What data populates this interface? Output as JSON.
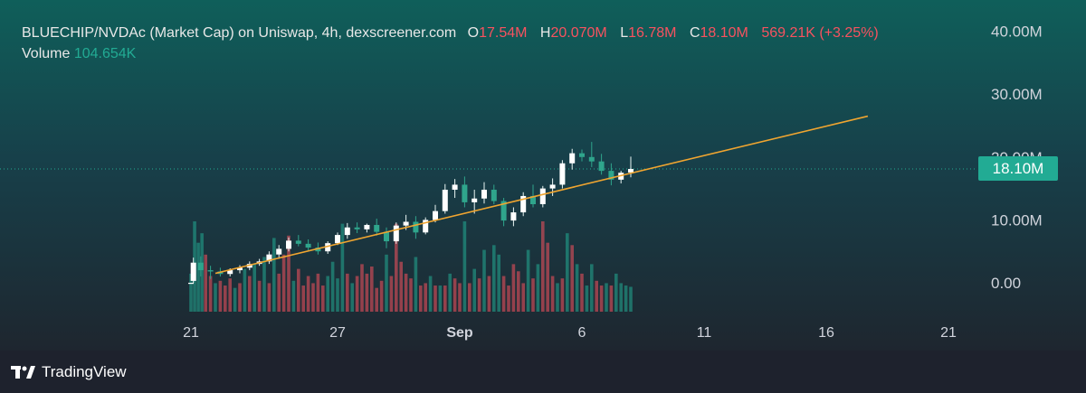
{
  "legend": {
    "title": "BLUECHIP/NVDAc (Market Cap) on Uniswap, 4h, dexscreener.com",
    "o_key": "O",
    "o_val": "17.54M",
    "h_key": "H",
    "h_val": "20.070M",
    "l_key": "L",
    "l_val": "16.78M",
    "c_key": "C",
    "c_val": "18.10M",
    "change": "569.21K (+3.25%)",
    "volume_label": "Volume",
    "volume_value": "104.654K"
  },
  "current_price_label": "18.10M",
  "brand": {
    "name": "TradingView",
    "icon": "tradingview-logo-icon"
  },
  "colors": {
    "up": "#22ab94",
    "down": "#f7525f",
    "candle_up_body": "#ffffff",
    "candle_down_body": "#2fa58c",
    "trendline": "#f0a530",
    "axis_text": "#d1d4dc"
  },
  "chart_data": {
    "type": "candlestick",
    "title": "",
    "x_axis": {
      "tick_labels": [
        "21",
        "27",
        "Sep",
        "6",
        "11",
        "16",
        "21"
      ],
      "tick_days": [
        -11,
        -5,
        0,
        5,
        10,
        15,
        20
      ]
    },
    "y_axis": {
      "tick_labels": [
        "0.00",
        "10.00M",
        "20.00M",
        "30.00M",
        "40.00M"
      ],
      "tick_values": [
        0,
        10,
        20,
        30,
        40
      ],
      "unit": "M",
      "ylim": [
        -2,
        41
      ]
    },
    "current_value": 18.1,
    "trendline": {
      "start": {
        "day": -10,
        "value": 1.5
      },
      "end": {
        "day": 16.7,
        "value": 26.5
      }
    },
    "candles": {
      "fields": [
        "day",
        "open",
        "high",
        "low",
        "close"
      ],
      "rows": [
        [
          -11.0,
          0.0,
          0.0,
          0.0,
          0.0
        ],
        [
          -10.9,
          0.3,
          4.0,
          0.0,
          3.2
        ],
        [
          -10.6,
          3.2,
          4.2,
          1.0,
          2.0
        ],
        [
          -10.2,
          2.0,
          2.7,
          0.6,
          1.8
        ],
        [
          -9.8,
          1.8,
          2.4,
          1.0,
          1.4
        ],
        [
          -9.4,
          1.4,
          2.3,
          1.0,
          2.0
        ],
        [
          -9.0,
          2.0,
          2.8,
          1.5,
          2.4
        ],
        [
          -8.6,
          2.4,
          3.4,
          2.0,
          3.0
        ],
        [
          -8.2,
          3.0,
          3.8,
          2.7,
          3.4
        ],
        [
          -7.8,
          3.4,
          5.0,
          3.0,
          4.5
        ],
        [
          -7.4,
          4.5,
          6.0,
          3.8,
          5.4
        ],
        [
          -7.0,
          5.4,
          7.2,
          5.0,
          6.7
        ],
        [
          -6.6,
          6.7,
          7.6,
          5.8,
          6.2
        ],
        [
          -6.2,
          6.2,
          6.9,
          5.0,
          5.6
        ],
        [
          -5.8,
          5.6,
          6.4,
          4.5,
          5.0
        ],
        [
          -5.4,
          5.0,
          6.6,
          4.6,
          6.3
        ],
        [
          -5.0,
          6.3,
          8.0,
          6.0,
          7.6
        ],
        [
          -4.6,
          7.6,
          9.5,
          7.0,
          8.8
        ],
        [
          -4.2,
          8.8,
          9.6,
          7.9,
          8.5
        ],
        [
          -3.8,
          8.5,
          9.4,
          8.0,
          9.2
        ],
        [
          -3.4,
          9.2,
          10.2,
          7.5,
          8.1
        ],
        [
          -3.0,
          8.1,
          8.8,
          5.5,
          6.6
        ],
        [
          -2.6,
          6.6,
          9.6,
          6.2,
          9.1
        ],
        [
          -2.2,
          9.1,
          10.8,
          8.4,
          9.7
        ],
        [
          -1.8,
          9.7,
          10.6,
          7.0,
          8.0
        ],
        [
          -1.4,
          8.0,
          10.4,
          7.7,
          10.0
        ],
        [
          -1.0,
          10.0,
          12.4,
          9.6,
          11.4
        ],
        [
          -0.6,
          11.4,
          15.7,
          11.0,
          14.8
        ],
        [
          -0.2,
          14.8,
          16.5,
          13.5,
          15.6
        ],
        [
          0.2,
          15.6,
          16.9,
          12.0,
          12.8
        ],
        [
          0.6,
          12.8,
          14.8,
          11.0,
          13.4
        ],
        [
          1.0,
          13.4,
          16.0,
          12.6,
          14.8
        ],
        [
          1.4,
          14.8,
          15.6,
          12.5,
          13.0
        ],
        [
          1.8,
          13.0,
          13.5,
          9.0,
          9.9
        ],
        [
          2.2,
          9.9,
          12.0,
          9.0,
          11.2
        ],
        [
          2.6,
          11.2,
          14.4,
          10.6,
          13.8
        ],
        [
          3.0,
          13.8,
          15.6,
          12.0,
          12.5
        ],
        [
          3.4,
          12.5,
          15.4,
          12.0,
          15.0
        ],
        [
          3.8,
          15.0,
          16.6,
          13.8,
          15.6
        ],
        [
          4.2,
          15.6,
          19.5,
          15.0,
          19.0
        ],
        [
          4.6,
          19.0,
          21.3,
          18.0,
          20.6
        ],
        [
          5.0,
          20.6,
          21.2,
          19.3,
          20.0
        ],
        [
          5.4,
          20.0,
          22.4,
          18.4,
          19.3
        ],
        [
          5.8,
          19.3,
          20.5,
          17.2,
          17.8
        ],
        [
          6.2,
          17.8,
          19.0,
          15.5,
          16.4
        ],
        [
          6.6,
          16.4,
          17.8,
          15.8,
          17.5
        ],
        [
          7.0,
          17.54,
          20.07,
          16.78,
          18.1
        ]
      ]
    },
    "volume": {
      "unit": "K",
      "fields": [
        "day",
        "value",
        "direction"
      ],
      "rows": [
        [
          -11.0,
          160,
          "up"
        ],
        [
          -10.85,
          380,
          "up"
        ],
        [
          -10.7,
          290,
          "up"
        ],
        [
          -10.55,
          330,
          "up"
        ],
        [
          -10.4,
          240,
          "down"
        ],
        [
          -10.2,
          150,
          "down"
        ],
        [
          -10.0,
          120,
          "up"
        ],
        [
          -9.8,
          130,
          "down"
        ],
        [
          -9.6,
          110,
          "down"
        ],
        [
          -9.4,
          140,
          "down"
        ],
        [
          -9.2,
          100,
          "up"
        ],
        [
          -9.0,
          120,
          "down"
        ],
        [
          -8.8,
          180,
          "up"
        ],
        [
          -8.6,
          150,
          "down"
        ],
        [
          -8.4,
          200,
          "up"
        ],
        [
          -8.2,
          130,
          "down"
        ],
        [
          -8.0,
          230,
          "up"
        ],
        [
          -7.8,
          120,
          "down"
        ],
        [
          -7.6,
          310,
          "up"
        ],
        [
          -7.4,
          160,
          "down"
        ],
        [
          -7.2,
          240,
          "down"
        ],
        [
          -7.0,
          320,
          "down"
        ],
        [
          -6.8,
          130,
          "up"
        ],
        [
          -6.6,
          180,
          "down"
        ],
        [
          -6.4,
          110,
          "down"
        ],
        [
          -6.2,
          150,
          "down"
        ],
        [
          -6.0,
          120,
          "down"
        ],
        [
          -5.8,
          160,
          "down"
        ],
        [
          -5.6,
          110,
          "down"
        ],
        [
          -5.4,
          150,
          "up"
        ],
        [
          -5.2,
          210,
          "up"
        ],
        [
          -5.0,
          140,
          "up"
        ],
        [
          -4.8,
          370,
          "up"
        ],
        [
          -4.6,
          160,
          "down"
        ],
        [
          -4.4,
          120,
          "up"
        ],
        [
          -4.2,
          150,
          "down"
        ],
        [
          -4.0,
          200,
          "down"
        ],
        [
          -3.8,
          160,
          "down"
        ],
        [
          -3.6,
          190,
          "down"
        ],
        [
          -3.4,
          100,
          "down"
        ],
        [
          -3.2,
          130,
          "down"
        ],
        [
          -3.0,
          240,
          "up"
        ],
        [
          -2.8,
          150,
          "down"
        ],
        [
          -2.6,
          370,
          "down"
        ],
        [
          -2.4,
          210,
          "down"
        ],
        [
          -2.2,
          160,
          "down"
        ],
        [
          -2.0,
          140,
          "down"
        ],
        [
          -1.8,
          230,
          "up"
        ],
        [
          -1.6,
          110,
          "down"
        ],
        [
          -1.4,
          120,
          "down"
        ],
        [
          -1.2,
          150,
          "up"
        ],
        [
          -1.0,
          110,
          "down"
        ],
        [
          -0.8,
          110,
          "up"
        ],
        [
          -0.6,
          110,
          "down"
        ],
        [
          -0.4,
          160,
          "up"
        ],
        [
          -0.2,
          140,
          "down"
        ],
        [
          0.0,
          120,
          "down"
        ],
        [
          0.2,
          380,
          "up"
        ],
        [
          0.4,
          120,
          "down"
        ],
        [
          0.6,
          180,
          "up"
        ],
        [
          0.8,
          140,
          "down"
        ],
        [
          1.0,
          260,
          "up"
        ],
        [
          1.2,
          150,
          "down"
        ],
        [
          1.4,
          280,
          "up"
        ],
        [
          1.6,
          240,
          "up"
        ],
        [
          1.8,
          150,
          "down"
        ],
        [
          2.0,
          110,
          "down"
        ],
        [
          2.2,
          200,
          "down"
        ],
        [
          2.4,
          170,
          "down"
        ],
        [
          2.6,
          120,
          "down"
        ],
        [
          2.8,
          260,
          "up"
        ],
        [
          3.0,
          140,
          "down"
        ],
        [
          3.2,
          200,
          "up"
        ],
        [
          3.4,
          380,
          "down"
        ],
        [
          3.6,
          290,
          "down"
        ],
        [
          3.8,
          150,
          "down"
        ],
        [
          4.0,
          120,
          "up"
        ],
        [
          4.2,
          140,
          "down"
        ],
        [
          4.4,
          330,
          "up"
        ],
        [
          4.6,
          280,
          "down"
        ],
        [
          4.8,
          200,
          "up"
        ],
        [
          5.0,
          160,
          "down"
        ],
        [
          5.2,
          110,
          "up"
        ],
        [
          5.4,
          200,
          "up"
        ],
        [
          5.6,
          130,
          "down"
        ],
        [
          5.8,
          110,
          "down"
        ],
        [
          6.0,
          120,
          "up"
        ],
        [
          6.2,
          110,
          "down"
        ],
        [
          6.4,
          160,
          "up"
        ],
        [
          6.6,
          120,
          "up"
        ],
        [
          6.8,
          110,
          "up"
        ],
        [
          7.0,
          104.654,
          "up"
        ]
      ]
    }
  }
}
